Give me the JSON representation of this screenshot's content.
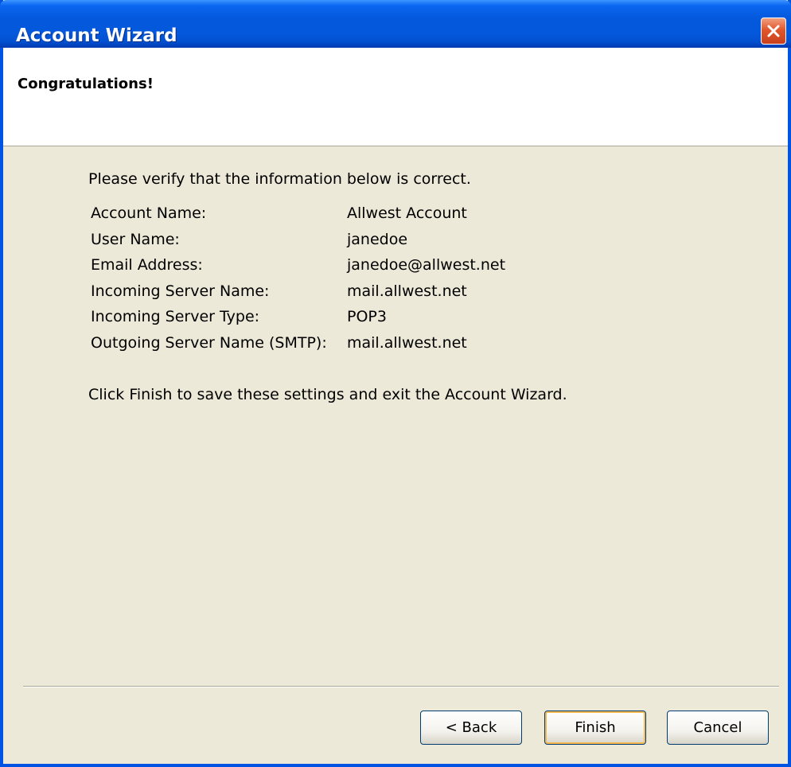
{
  "window": {
    "title": "Account Wizard"
  },
  "header": {
    "title": "Congratulations!"
  },
  "content": {
    "intro": "Please verify that the information below is correct.",
    "rows": [
      {
        "label": "Account Name:",
        "value": "Allwest Account"
      },
      {
        "label": "User Name:",
        "value": "janedoe"
      },
      {
        "label": "Email Address:",
        "value": "janedoe@allwest.net"
      },
      {
        "label": "Incoming Server Name:",
        "value": "mail.allwest.net"
      },
      {
        "label": "Incoming Server Type:",
        "value": "POP3"
      },
      {
        "label": "Outgoing Server Name (SMTP):",
        "value": "mail.allwest.net"
      }
    ],
    "finish_note": "Click Finish to save these settings and exit the Account Wizard."
  },
  "buttons": {
    "back": "< Back",
    "finish": "Finish",
    "cancel": "Cancel"
  },
  "icons": {
    "close": "close-icon"
  },
  "colors": {
    "titlebar": "#0458dc",
    "dialog_bg": "#ece9d8",
    "close_button": "#e2562c",
    "default_button_focus": "#f8b850"
  }
}
